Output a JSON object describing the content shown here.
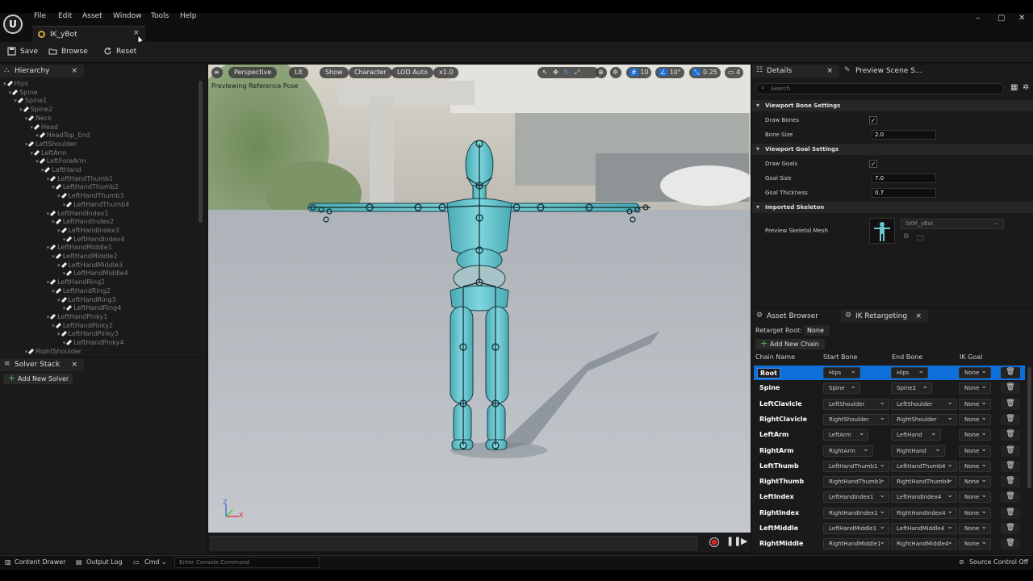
{
  "menu": {
    "items": [
      "File",
      "Edit",
      "Asset",
      "Window",
      "Tools",
      "Help"
    ]
  },
  "document_tab": {
    "label": "IK_yBot",
    "close": "×"
  },
  "toolbar": {
    "save": "Save",
    "browse": "Browse",
    "reset": "Reset"
  },
  "hierarchy": {
    "title": "Hierarchy",
    "close": "×",
    "bones": [
      {
        "name": "Hips",
        "depth": 0
      },
      {
        "name": "Spine",
        "depth": 1
      },
      {
        "name": "Spine1",
        "depth": 2
      },
      {
        "name": "Spine2",
        "depth": 3
      },
      {
        "name": "Neck",
        "depth": 4
      },
      {
        "name": "Head",
        "depth": 5
      },
      {
        "name": "HeadTop_End",
        "depth": 6
      },
      {
        "name": "LeftShoulder",
        "depth": 4
      },
      {
        "name": "LeftArm",
        "depth": 5
      },
      {
        "name": "LeftForeArm",
        "depth": 6
      },
      {
        "name": "LeftHand",
        "depth": 7
      },
      {
        "name": "LeftHandThumb1",
        "depth": 8
      },
      {
        "name": "LeftHandThumb2",
        "depth": 9
      },
      {
        "name": "LeftHandThumb3",
        "depth": 10
      },
      {
        "name": "LeftHandThumb4",
        "depth": 11
      },
      {
        "name": "LeftHandIndex1",
        "depth": 8
      },
      {
        "name": "LeftHandIndex2",
        "depth": 9
      },
      {
        "name": "LeftHandIndex3",
        "depth": 10
      },
      {
        "name": "LeftHandIndex4",
        "depth": 11
      },
      {
        "name": "LeftHandMiddle1",
        "depth": 8
      },
      {
        "name": "LeftHandMiddle2",
        "depth": 9
      },
      {
        "name": "LeftHandMiddle3",
        "depth": 10
      },
      {
        "name": "LeftHandMiddle4",
        "depth": 11
      },
      {
        "name": "LeftHandRing1",
        "depth": 8
      },
      {
        "name": "LeftHandRing2",
        "depth": 9
      },
      {
        "name": "LeftHandRing3",
        "depth": 10
      },
      {
        "name": "LeftHandRing4",
        "depth": 11
      },
      {
        "name": "LeftHandPinky1",
        "depth": 8
      },
      {
        "name": "LeftHandPinky2",
        "depth": 9
      },
      {
        "name": "LeftHandPinky3",
        "depth": 10
      },
      {
        "name": "LeftHandPinky4",
        "depth": 11
      },
      {
        "name": "RightShoulder",
        "depth": 4
      }
    ]
  },
  "solver_stack": {
    "title": "Solver Stack",
    "close": "×",
    "add_button": "Add New Solver"
  },
  "viewport": {
    "perspective": "Perspective",
    "lit": "Lit",
    "show": "Show",
    "character": "Character",
    "lod": "LOD Auto",
    "speed": "x1.0",
    "overlay_text": "Previewing Reference Pose",
    "grid_value": "10",
    "angle_value": "10°",
    "scale_value": "0.25",
    "camera_speed": "4",
    "axis_z": "Z",
    "axis_x": "X"
  },
  "details": {
    "title": "Details",
    "close": "×",
    "preview_tab": "Preview Scene S...",
    "search_placeholder": "Search",
    "sections": {
      "bone": "Viewport Bone Settings",
      "goal": "Viewport Goal Settings",
      "skeleton": "Imported Skeleton"
    },
    "draw_bones_label": "Draw Bones",
    "draw_bones": "✓",
    "bone_size_label": "Bone Size",
    "bone_size": "2.0",
    "draw_goals_label": "Draw Goals",
    "draw_goals": "✓",
    "goal_size_label": "Goal Size",
    "goal_size": "7.0",
    "goal_thickness_label": "Goal Thickness",
    "goal_thickness": "0.7",
    "preview_mesh_label": "Preview Skeletal Mesh",
    "preview_mesh": "SKM_yBot"
  },
  "retargeting": {
    "asset_browser_tab": "Asset Browser",
    "ik_tab": "IK Retargeting",
    "close": "×",
    "retarget_root_label": "Retarget Root:",
    "retarget_root": "None",
    "add_chain": "Add New Chain",
    "headers": {
      "chain": "Chain Name",
      "start": "Start Bone",
      "end": "End Bone",
      "goal": "IK Goal"
    },
    "chains": [
      {
        "name": "Root",
        "start": "Hips",
        "end": "Hips",
        "goal": "None"
      },
      {
        "name": "Spine",
        "start": "Spine",
        "end": "Spine2",
        "goal": "None"
      },
      {
        "name": "LeftClavicle",
        "start": "LeftShoulder",
        "end": "LeftShoulder",
        "goal": "None"
      },
      {
        "name": "RightClavicle",
        "start": "RightShoulder",
        "end": "RightShoulder",
        "goal": "None"
      },
      {
        "name": "LeftArm",
        "start": "LeftArm",
        "end": "LeftHand",
        "goal": "None"
      },
      {
        "name": "RightArm",
        "start": "RightArm",
        "end": "RightHand",
        "goal": "None"
      },
      {
        "name": "LeftThumb",
        "start": "LeftHandThumb1",
        "end": "LeftHandThumb4",
        "goal": "None"
      },
      {
        "name": "RightThumb",
        "start": "RightHandThumb1",
        "end": "RightHandThumb4",
        "goal": "None"
      },
      {
        "name": "LeftIndex",
        "start": "LeftHandIndex1",
        "end": "LeftHandIndex4",
        "goal": "None"
      },
      {
        "name": "RightIndex",
        "start": "RightHandIndex1",
        "end": "RightHandIndex4",
        "goal": "None"
      },
      {
        "name": "LeftMiddle",
        "start": "LeftHandMiddle1",
        "end": "LeftHandMiddle4",
        "goal": "None"
      },
      {
        "name": "RightMiddle",
        "start": "RightHandMiddle1",
        "end": "RightHandMiddle4",
        "goal": "None"
      }
    ]
  },
  "statusbar": {
    "content_drawer": "Content Drawer",
    "output_log": "Output Log",
    "cmd": "Cmd",
    "console_placeholder": "Enter Console Command",
    "source_control": "Source Control Off"
  },
  "colors": {
    "accent_blue": "#0f6fd8",
    "mannequin": "#6fc6cf",
    "panel": "#1a1a1a"
  }
}
